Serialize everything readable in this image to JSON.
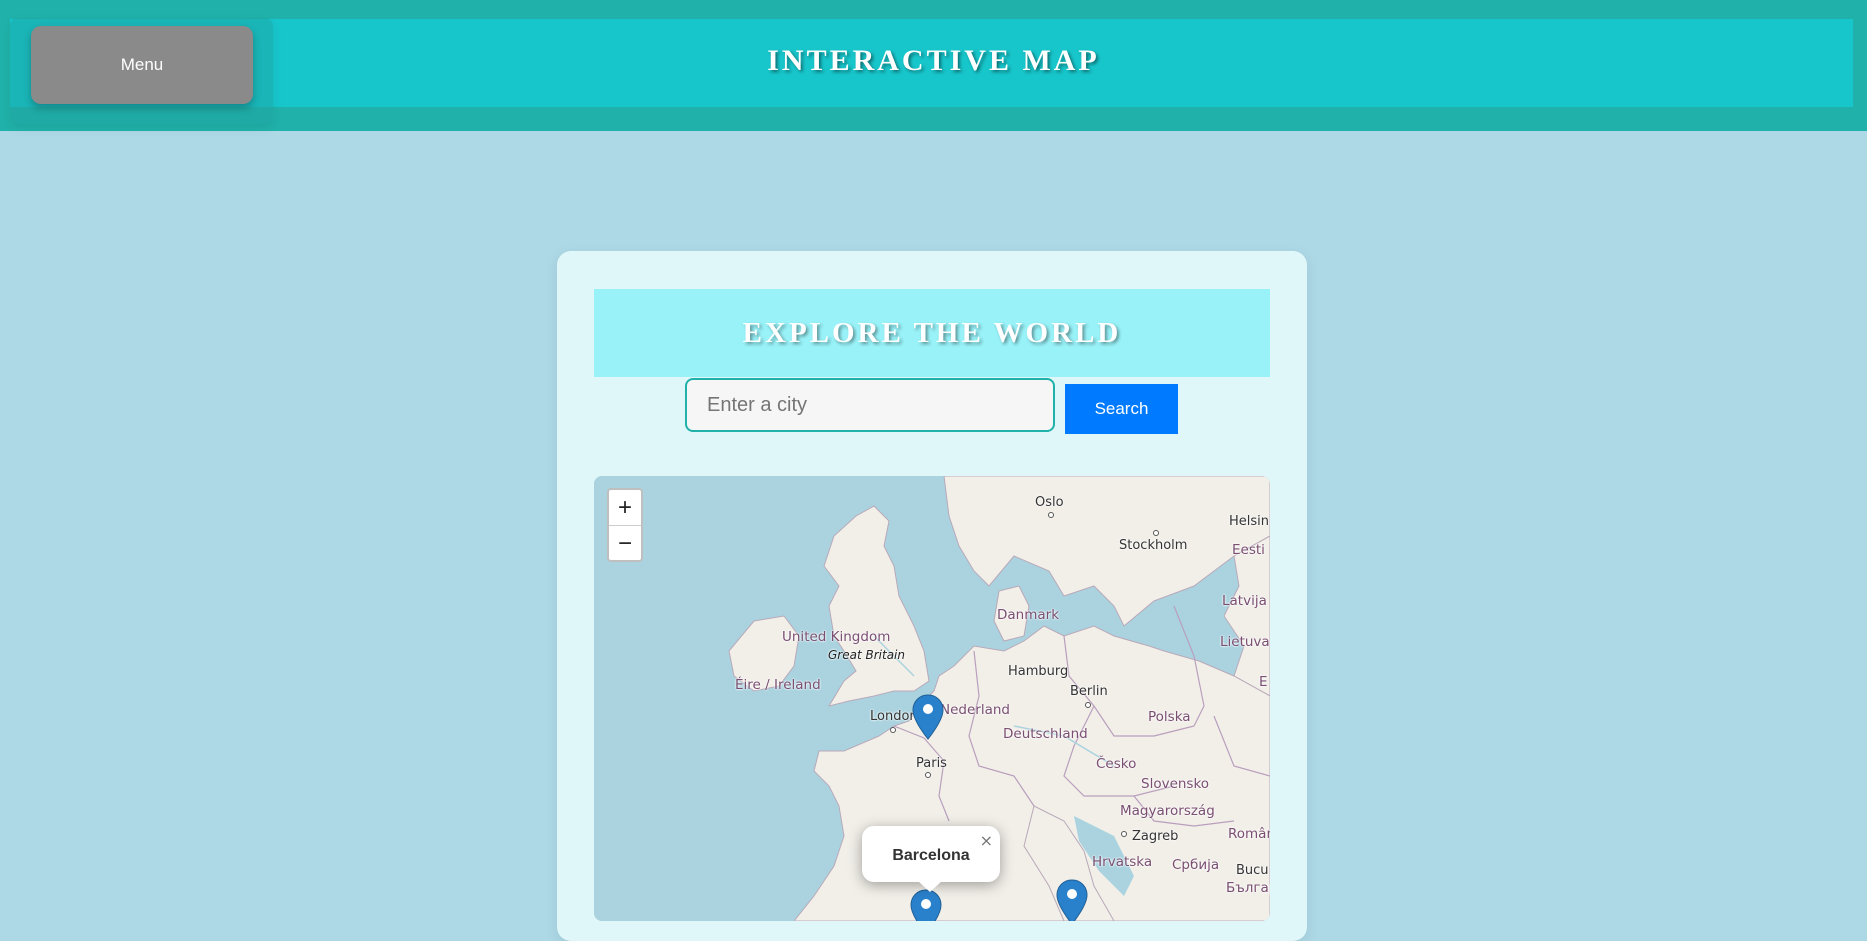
{
  "header": {
    "menu_label": "Menu",
    "title": "INTERACTIVE MAP"
  },
  "card": {
    "title": "EXPLORE THE WORLD",
    "search_placeholder": "Enter a city",
    "search_value": "",
    "search_button": "Search"
  },
  "map": {
    "zoom_in": "+",
    "zoom_out": "−",
    "labels": {
      "oslo": "Oslo",
      "stockholm": "Stockholm",
      "helsinki": "Helsin",
      "eesti": "Eesti",
      "latvija": "Latvija",
      "lietuva": "Lietuva",
      "danmark": "Danmark",
      "united_kingdom": "United Kingdom",
      "great_britain": "Great Britain",
      "eire": "Éire / Ireland",
      "hamburg": "Hamburg",
      "berlin": "Berlin",
      "london": "London",
      "nederland": "Nederland",
      "polska": "Polska",
      "deutschland": "Deutschland",
      "paris": "Paris",
      "cesko": "Česko",
      "slovensko": "Slovensko",
      "magyarorszag": "Magyarország",
      "zagreb": "Zagreb",
      "romania": "Româniа",
      "hrvatska": "Hrvatska",
      "srbija": "Србија",
      "bucuresti": "Bucu",
      "bulgaria": "Българ",
      "e": "E"
    },
    "markers": [
      "Paris",
      "Barcelona",
      "Rome"
    ],
    "popup": {
      "text": "Barcelona",
      "close": "×"
    }
  },
  "colors": {
    "teal": "#20b2aa",
    "accent": "#007bff",
    "water": "#aad3df",
    "land": "#f2efe9",
    "marker": "#2a81cb"
  }
}
